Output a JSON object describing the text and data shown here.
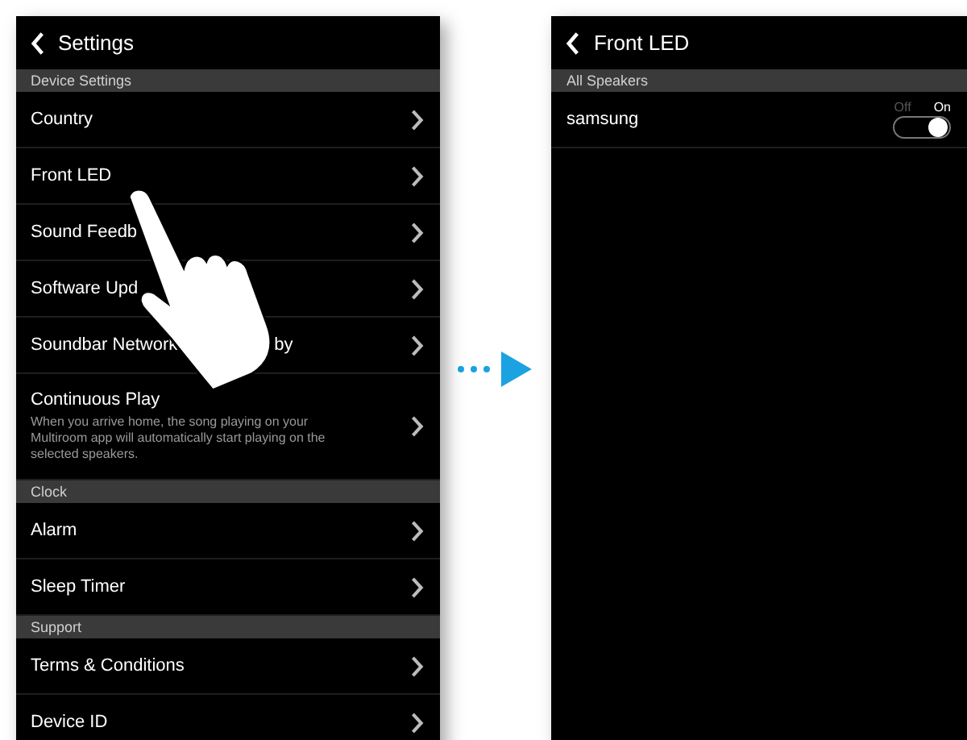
{
  "settings_screen": {
    "title": "Settings",
    "sections": [
      {
        "header": "Device Settings",
        "items": [
          {
            "label": "Country"
          },
          {
            "label": "Front LED"
          },
          {
            "label": "Sound Feedb"
          },
          {
            "label": "Software Upd"
          },
          {
            "label": "Soundbar Network",
            "label_after": "by"
          },
          {
            "label": "Continuous Play",
            "description": "When you arrive home, the song playing on your Multiroom app will automatically start playing on the selected speakers."
          }
        ]
      },
      {
        "header": "Clock",
        "items": [
          {
            "label": "Alarm"
          },
          {
            "label": "Sleep Timer"
          }
        ]
      },
      {
        "header": "Support",
        "items": [
          {
            "label": "Terms & Conditions"
          },
          {
            "label": "Device ID"
          }
        ]
      }
    ]
  },
  "front_led_screen": {
    "title": "Front LED",
    "sections": [
      {
        "header": "All Speakers",
        "items": [
          {
            "label": "samsung",
            "toggle": {
              "off_label": "Off",
              "on_label": "On",
              "on": true
            }
          }
        ]
      }
    ]
  }
}
